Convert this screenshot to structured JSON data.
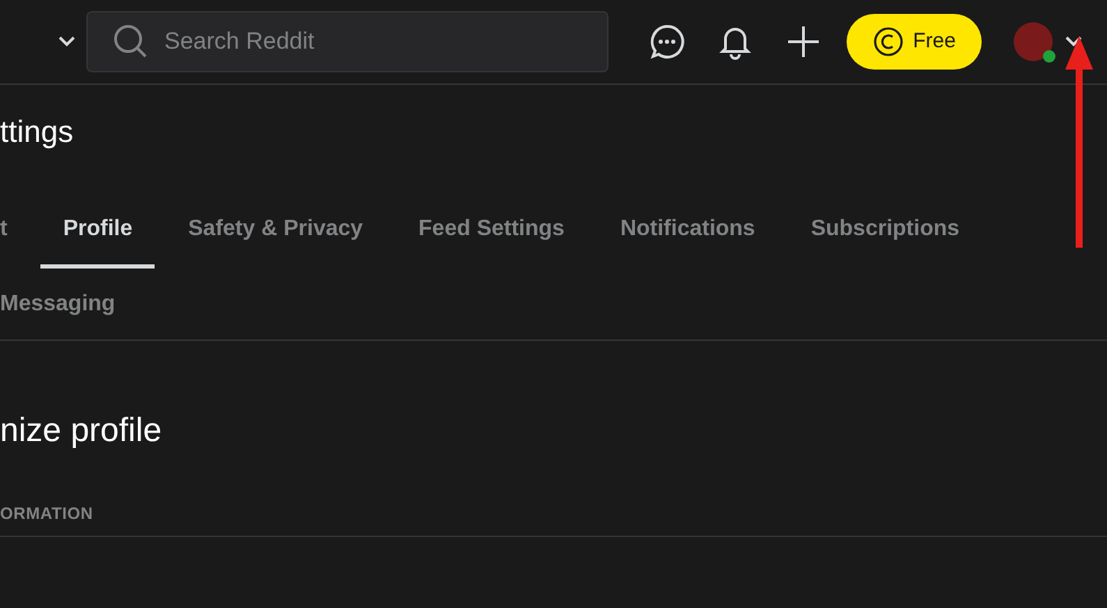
{
  "header": {
    "search": {
      "placeholder": "Search Reddit"
    },
    "premium_button": {
      "label": "Free"
    }
  },
  "page_title": "ttings",
  "tabs": [
    {
      "label": "t",
      "selected": false
    },
    {
      "label": "Profile",
      "selected": true
    },
    {
      "label": "Safety & Privacy",
      "selected": false
    },
    {
      "label": "Feed Settings",
      "selected": false
    },
    {
      "label": "Notifications",
      "selected": false
    },
    {
      "label": "Subscriptions",
      "selected": false
    },
    {
      "label": "Messaging",
      "selected": false
    }
  ],
  "section_title": "nize profile",
  "section_label": "ORMATION"
}
